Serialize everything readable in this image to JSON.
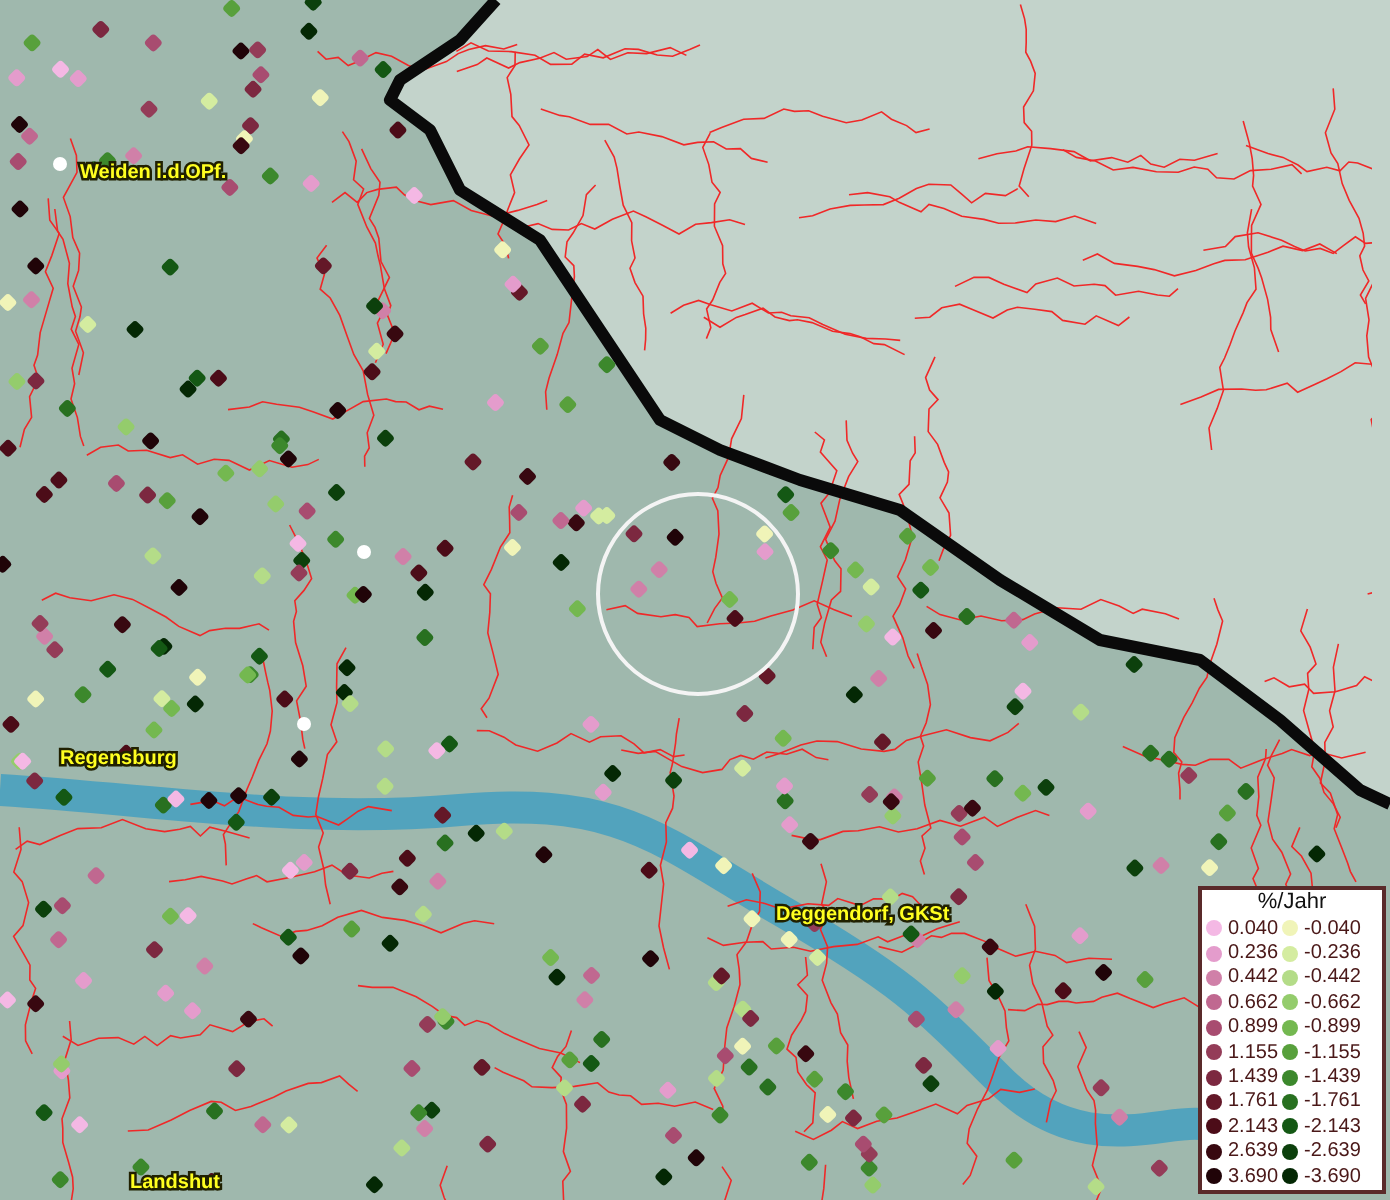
{
  "map": {
    "place_labels": [
      "Weiden i.d.OPf.",
      "Regensburg",
      "Deggendorf, GKSt",
      "Landshut"
    ]
  },
  "legend": {
    "title": "%/Jahr",
    "positive": [
      {
        "value": "0.040",
        "color": "#f4b8e4"
      },
      {
        "value": "0.236",
        "color": "#e49ccc"
      },
      {
        "value": "0.442",
        "color": "#d080a8"
      },
      {
        "value": "0.662",
        "color": "#c06890"
      },
      {
        "value": "0.899",
        "color": "#a84c70"
      },
      {
        "value": "1.155",
        "color": "#943c58"
      },
      {
        "value": "1.439",
        "color": "#7c2840"
      },
      {
        "value": "1.761",
        "color": "#641828"
      },
      {
        "value": "2.143",
        "color": "#4c0c18"
      },
      {
        "value": "2.639",
        "color": "#380810"
      },
      {
        "value": "3.690",
        "color": "#200408"
      }
    ],
    "negative": [
      {
        "value": "-0.040",
        "color": "#f0f4b8"
      },
      {
        "value": "-0.236",
        "color": "#d4eca0"
      },
      {
        "value": "-0.442",
        "color": "#b4dc88"
      },
      {
        "value": "-0.662",
        "color": "#94cc6c"
      },
      {
        "value": "-0.899",
        "color": "#74b850"
      },
      {
        "value": "-1.155",
        "color": "#58a03c"
      },
      {
        "value": "-1.439",
        "color": "#3c882c"
      },
      {
        "value": "-1.761",
        "color": "#287020"
      },
      {
        "value": "-2.143",
        "color": "#145814"
      },
      {
        "value": "-2.639",
        "color": "#0c400c"
      },
      {
        "value": "-3.690",
        "color": "#042804"
      }
    ]
  }
}
